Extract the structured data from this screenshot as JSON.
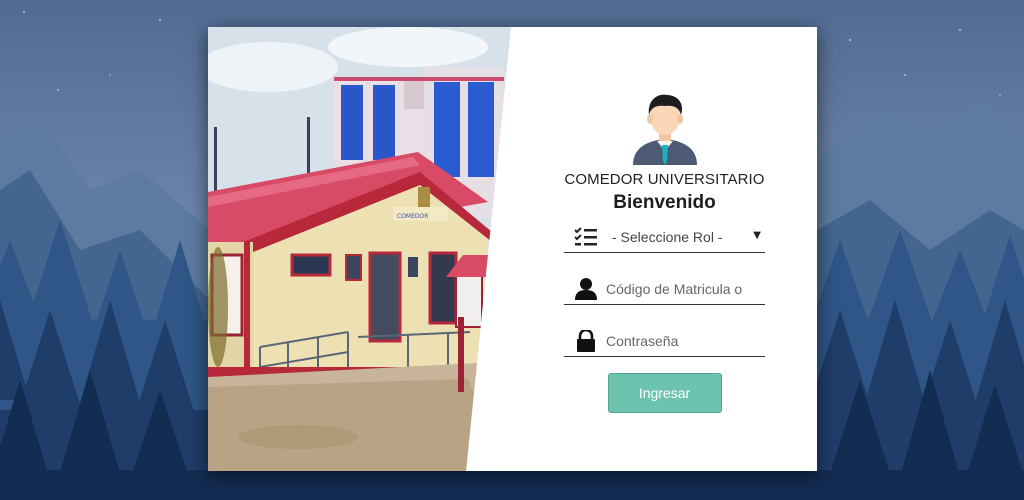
{
  "app": {
    "title": "COMEDOR UNIVERSITARIO",
    "welcome": "Bienvenido"
  },
  "form": {
    "role_select": {
      "selected": "- Seleccione Rol -"
    },
    "user_field": {
      "placeholder": "Código de Matricula o"
    },
    "password_field": {
      "placeholder": "Contraseña"
    },
    "submit_label": "Ingresar"
  },
  "colors": {
    "accent": "#6cc3ae",
    "background": "#4b6387"
  },
  "icons": {
    "role": "checklist-icon",
    "user": "user-icon",
    "password": "lock-icon",
    "avatar": "avatar-icon"
  }
}
